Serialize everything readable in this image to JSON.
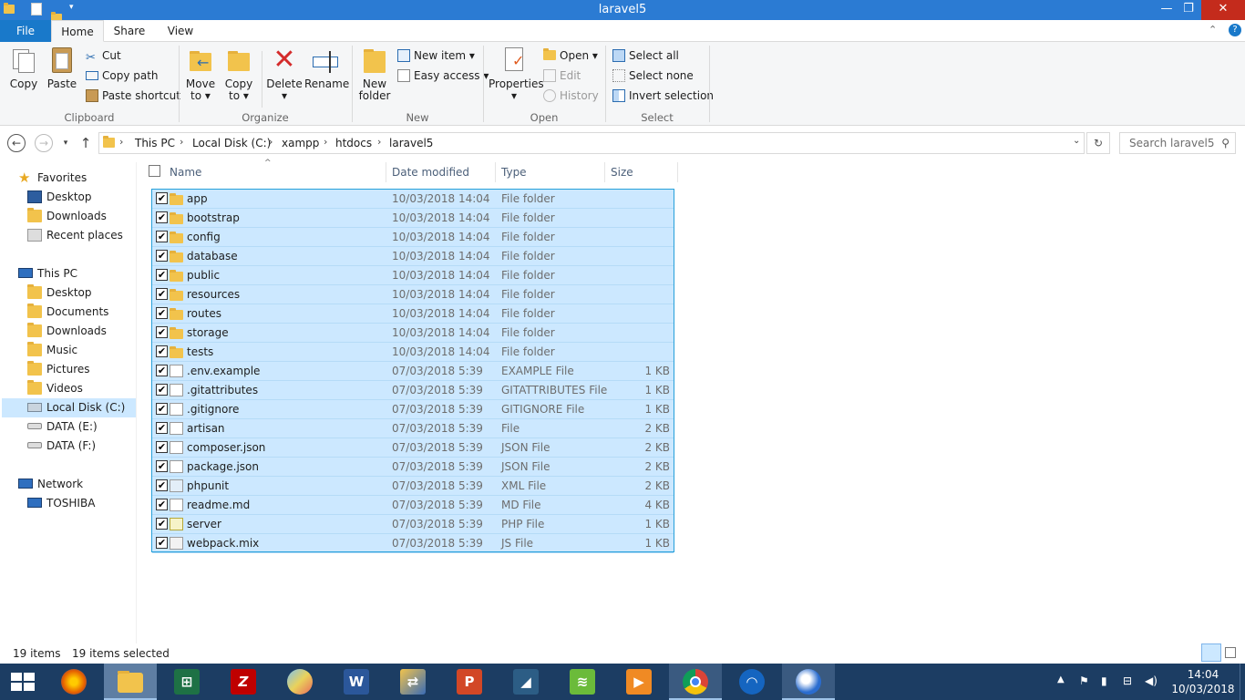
{
  "window": {
    "title": "laravel5",
    "minimize": "—",
    "maximize": "❐",
    "close": "✕"
  },
  "ribbon_tabs": {
    "file": "File",
    "home": "Home",
    "share": "Share",
    "view": "View"
  },
  "ribbon": {
    "clipboard": {
      "label": "Clipboard",
      "copy": "Copy",
      "paste": "Paste",
      "cut": "Cut",
      "copy_path": "Copy path",
      "paste_shortcut": "Paste shortcut"
    },
    "organize": {
      "label": "Organize",
      "move_to": "Move",
      "move_to2": "to ▾",
      "copy_to": "Copy",
      "copy_to2": "to ▾",
      "delete": "Delete",
      "delete2": "▾",
      "rename": "Rename"
    },
    "new": {
      "label": "New",
      "new_folder": "New",
      "new_folder2": "folder",
      "new_item": "New item ▾",
      "easy_access": "Easy access ▾"
    },
    "open": {
      "label": "Open",
      "properties": "Properties",
      "properties2": "▾",
      "open": "Open ▾",
      "edit": "Edit",
      "history": "History"
    },
    "select": {
      "label": "Select",
      "select_all": "Select all",
      "select_none": "Select none",
      "invert_selection": "Invert selection"
    }
  },
  "address": {
    "crumbs": [
      "This PC",
      "Local Disk (C:)",
      "xampp",
      "htdocs",
      "laravel5"
    ],
    "search_placeholder": "Search laravel5"
  },
  "nav_pane": {
    "favorites": "Favorites",
    "fav_items": [
      "Desktop",
      "Downloads",
      "Recent places"
    ],
    "this_pc": "This PC",
    "pc_items": [
      "Desktop",
      "Documents",
      "Downloads",
      "Music",
      "Pictures",
      "Videos",
      "Local Disk (C:)",
      "DATA (E:)",
      "DATA (F:)"
    ],
    "network": "Network",
    "net_items": [
      "TOSHIBA"
    ]
  },
  "columns": {
    "name": "Name",
    "date": "Date modified",
    "type": "Type",
    "size": "Size"
  },
  "files": [
    {
      "name": "app",
      "date": "10/03/2018 14:04",
      "type": "File folder",
      "size": "",
      "icon": "folder"
    },
    {
      "name": "bootstrap",
      "date": "10/03/2018 14:04",
      "type": "File folder",
      "size": "",
      "icon": "folder"
    },
    {
      "name": "config",
      "date": "10/03/2018 14:04",
      "type": "File folder",
      "size": "",
      "icon": "folder"
    },
    {
      "name": "database",
      "date": "10/03/2018 14:04",
      "type": "File folder",
      "size": "",
      "icon": "folder"
    },
    {
      "name": "public",
      "date": "10/03/2018 14:04",
      "type": "File folder",
      "size": "",
      "icon": "folder"
    },
    {
      "name": "resources",
      "date": "10/03/2018 14:04",
      "type": "File folder",
      "size": "",
      "icon": "folder"
    },
    {
      "name": "routes",
      "date": "10/03/2018 14:04",
      "type": "File folder",
      "size": "",
      "icon": "folder"
    },
    {
      "name": "storage",
      "date": "10/03/2018 14:04",
      "type": "File folder",
      "size": "",
      "icon": "folder"
    },
    {
      "name": "tests",
      "date": "10/03/2018 14:04",
      "type": "File folder",
      "size": "",
      "icon": "folder"
    },
    {
      "name": ".env.example",
      "date": "07/03/2018 5:39",
      "type": "EXAMPLE File",
      "size": "1 KB",
      "icon": "file"
    },
    {
      "name": ".gitattributes",
      "date": "07/03/2018 5:39",
      "type": "GITATTRIBUTES File",
      "size": "1 KB",
      "icon": "file"
    },
    {
      "name": ".gitignore",
      "date": "07/03/2018 5:39",
      "type": "GITIGNORE File",
      "size": "1 KB",
      "icon": "file"
    },
    {
      "name": "artisan",
      "date": "07/03/2018 5:39",
      "type": "File",
      "size": "2 KB",
      "icon": "file"
    },
    {
      "name": "composer.json",
      "date": "07/03/2018 5:39",
      "type": "JSON File",
      "size": "2 KB",
      "icon": "file"
    },
    {
      "name": "package.json",
      "date": "07/03/2018 5:39",
      "type": "JSON File",
      "size": "2 KB",
      "icon": "file"
    },
    {
      "name": "phpunit",
      "date": "07/03/2018 5:39",
      "type": "XML File",
      "size": "2 KB",
      "icon": "xml"
    },
    {
      "name": "readme.md",
      "date": "07/03/2018 5:39",
      "type": "MD File",
      "size": "4 KB",
      "icon": "file"
    },
    {
      "name": "server",
      "date": "07/03/2018 5:39",
      "type": "PHP File",
      "size": "1 KB",
      "icon": "php"
    },
    {
      "name": "webpack.mix",
      "date": "07/03/2018 5:39",
      "type": "JS File",
      "size": "1 KB",
      "icon": "js"
    }
  ],
  "status": {
    "count": "19 items",
    "selected": "19 items selected"
  },
  "taskbar": {
    "apps": [
      "start",
      "firefox",
      "file-explorer",
      "excel",
      "filezilla",
      "paint",
      "word",
      "network-tool",
      "powerpoint",
      "mysql-workbench",
      "sublime",
      "media-player",
      "chrome",
      "browser",
      "thunderbird"
    ],
    "time": "14:04",
    "date": "10/03/2018"
  },
  "colors": {
    "titlebar": "#2b7bd3",
    "selection": "#cce8ff",
    "selection_border": "#26a0da",
    "taskbar": "#1c3d63"
  }
}
